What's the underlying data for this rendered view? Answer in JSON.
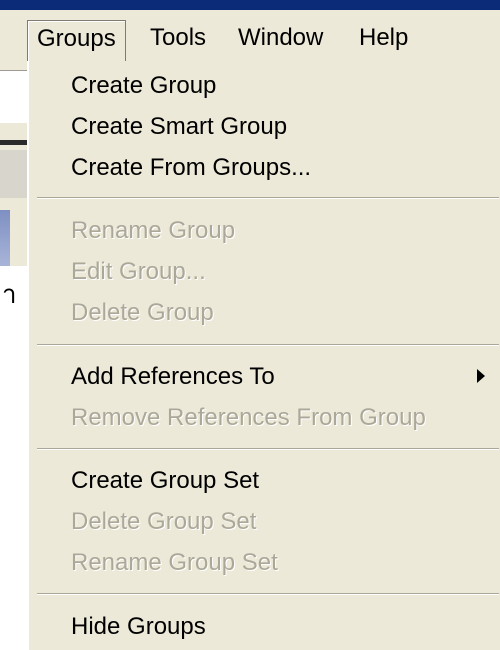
{
  "menubar": {
    "items": [
      {
        "label": "Groups"
      },
      {
        "label": "Tools"
      },
      {
        "label": "Window"
      },
      {
        "label": "Help"
      }
    ]
  },
  "background": {
    "partial_glyph": "า"
  },
  "groups_menu": {
    "items": [
      {
        "label": "Create Group",
        "enabled": true
      },
      {
        "label": "Create Smart Group",
        "enabled": true
      },
      {
        "label": "Create From Groups...",
        "enabled": true
      },
      {
        "label": "Rename Group",
        "enabled": false
      },
      {
        "label": "Edit Group...",
        "enabled": false
      },
      {
        "label": "Delete Group",
        "enabled": false
      },
      {
        "label": "Add References To",
        "enabled": true,
        "has_submenu": true,
        "submenu_icon": "submenu-arrow-icon"
      },
      {
        "label": "Remove References From Group",
        "enabled": false
      },
      {
        "label": "Create Group Set",
        "enabled": true
      },
      {
        "label": "Delete Group Set",
        "enabled": false
      },
      {
        "label": "Rename Group Set",
        "enabled": false
      },
      {
        "label": "Hide Groups",
        "enabled": true
      }
    ]
  },
  "colors": {
    "menu_background": "#ece9d8",
    "disabled_text": "#aca899",
    "title_bar": "#0b2a78"
  }
}
